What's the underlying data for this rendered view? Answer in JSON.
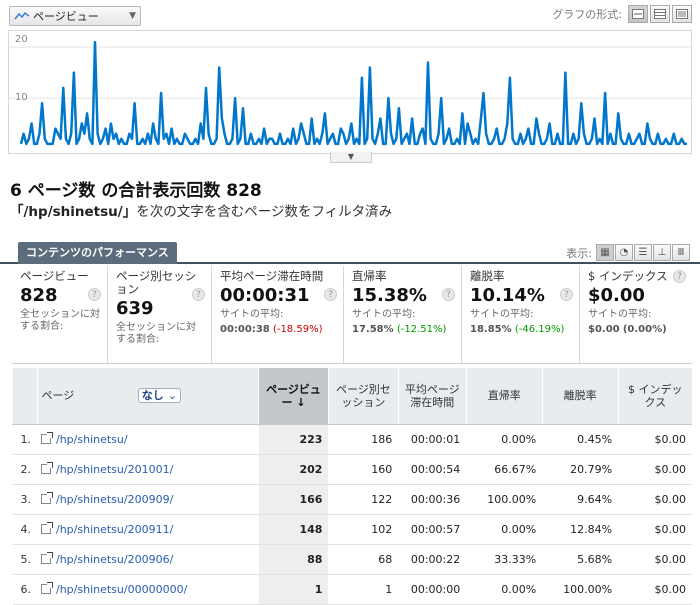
{
  "toolbar": {
    "metric_select": "ページビュー",
    "graph_format_label": "グラフの形式:"
  },
  "chart_data": {
    "type": "line",
    "ytick_labels": [
      "20",
      "10"
    ],
    "ylim": [
      0,
      22
    ],
    "color": "#0077cc",
    "series": [
      {
        "values": [
          1,
          3,
          1,
          2,
          5,
          1,
          1,
          3,
          9,
          2,
          1,
          1,
          1,
          4,
          3,
          2,
          12,
          2,
          1,
          3,
          15,
          1,
          2,
          5,
          3,
          7,
          2,
          1,
          21,
          3,
          1,
          2,
          4,
          1,
          5,
          2,
          3,
          1,
          2,
          1,
          1,
          3,
          2,
          9,
          1,
          1,
          2,
          1,
          3,
          1,
          5,
          2,
          1,
          11,
          2,
          3,
          1,
          4,
          1,
          2,
          1,
          1,
          3,
          2,
          1,
          1,
          2,
          1,
          5,
          2,
          12,
          3,
          1,
          1,
          2,
          16,
          6,
          3,
          1,
          1,
          2,
          10,
          1,
          2,
          8,
          1,
          1,
          3,
          1,
          1,
          2,
          1,
          4,
          1,
          2,
          2,
          1,
          1,
          3,
          1,
          1,
          2,
          1,
          4,
          1,
          2,
          5,
          3,
          1,
          1,
          6,
          1,
          2,
          1,
          3,
          7,
          1,
          2,
          3,
          1,
          1,
          4,
          3,
          1,
          2,
          5,
          1,
          2,
          1,
          14,
          1,
          2,
          16,
          2,
          1,
          3,
          6,
          1,
          1,
          10,
          3,
          1,
          2,
          8,
          1,
          2,
          3,
          1,
          6,
          1,
          1,
          3,
          4,
          1,
          17,
          2,
          1,
          1,
          3,
          10,
          1,
          2,
          4,
          1,
          1,
          2,
          1,
          7,
          1,
          5,
          3,
          1,
          2,
          1,
          6,
          11,
          3,
          1,
          1,
          2,
          4,
          1,
          1,
          2,
          5,
          14,
          2,
          1,
          1,
          3,
          1,
          2,
          4,
          1,
          1,
          6,
          3,
          1,
          1,
          2,
          5,
          1,
          1,
          3,
          1,
          1,
          15,
          1,
          1,
          3,
          1,
          2,
          9,
          3,
          1,
          1,
          2,
          6,
          1,
          2,
          1,
          11,
          1,
          3,
          1,
          1,
          7,
          2,
          1,
          1,
          3,
          1,
          1,
          2,
          3,
          1,
          1,
          5,
          2,
          1,
          1,
          3,
          1,
          1,
          2,
          1,
          1,
          3,
          1,
          1,
          2,
          1,
          1
        ]
      }
    ]
  },
  "headline": {
    "count": "6",
    "mid": "ページ数 の合計表示回数",
    "total": "828"
  },
  "subline": {
    "filter": "「/hp/shinetsu/」",
    "text": "を次の文字を含むページ数をフィルタ済み"
  },
  "tab": {
    "label": "コンテンツのパフォーマンス"
  },
  "view_label": "表示:",
  "summary": [
    {
      "label": "ページビュー",
      "value": "828",
      "note": "全セッションに対する割合:",
      "avg": "",
      "delta": "",
      "delta_sign": ""
    },
    {
      "label": "ページ別セッション",
      "value": "639",
      "note": "全セッションに対する割合:",
      "avg": "",
      "delta": "",
      "delta_sign": ""
    },
    {
      "label": "平均ページ滞在時間",
      "value": "00:00:31",
      "note": "サイトの平均:",
      "avg": "00:00:38",
      "delta": "(-18.59%)",
      "delta_sign": "neg"
    },
    {
      "label": "直帰率",
      "value": "15.38%",
      "note": "サイトの平均:",
      "avg": "17.58%",
      "delta": "(-12.51%)",
      "delta_sign": "pos"
    },
    {
      "label": "離脱率",
      "value": "10.14%",
      "note": "サイトの平均:",
      "avg": "18.85%",
      "delta": "(-46.19%)",
      "delta_sign": "pos"
    },
    {
      "label": "$ インデックス",
      "value": "$0.00",
      "note": "サイトの平均:",
      "avg": "$0.00",
      "delta": "(0.00%)",
      "delta_sign": ""
    }
  ],
  "table": {
    "headers": {
      "page": "ページ",
      "filter": "なし",
      "pageviews": "ページビュー",
      "sessions": "ページ別セッション",
      "avg_time": "平均ページ滞在時間",
      "bounce": "直帰率",
      "exit": "離脱率",
      "index": "$ インデックス"
    },
    "rows": [
      {
        "rank": "1.",
        "page": "/hp/shinetsu/",
        "pageviews": "223",
        "sessions": "186",
        "avg_time": "00:00:01",
        "bounce": "0.00%",
        "exit": "0.45%",
        "index": "$0.00"
      },
      {
        "rank": "2.",
        "page": "/hp/shinetsu/201001/",
        "pageviews": "202",
        "sessions": "160",
        "avg_time": "00:00:54",
        "bounce": "66.67%",
        "exit": "20.79%",
        "index": "$0.00"
      },
      {
        "rank": "3.",
        "page": "/hp/shinetsu/200909/",
        "pageviews": "166",
        "sessions": "122",
        "avg_time": "00:00:36",
        "bounce": "100.00%",
        "exit": "9.64%",
        "index": "$0.00"
      },
      {
        "rank": "4.",
        "page": "/hp/shinetsu/200911/",
        "pageviews": "148",
        "sessions": "102",
        "avg_time": "00:00:57",
        "bounce": "0.00%",
        "exit": "12.84%",
        "index": "$0.00"
      },
      {
        "rank": "5.",
        "page": "/hp/shinetsu/200906/",
        "pageviews": "88",
        "sessions": "68",
        "avg_time": "00:00:22",
        "bounce": "33.33%",
        "exit": "5.68%",
        "index": "$0.00"
      },
      {
        "rank": "6.",
        "page": "/hp/shinetsu/00000000/",
        "pageviews": "1",
        "sessions": "1",
        "avg_time": "00:00:00",
        "bounce": "0.00%",
        "exit": "100.00%",
        "index": "$0.00"
      }
    ]
  }
}
